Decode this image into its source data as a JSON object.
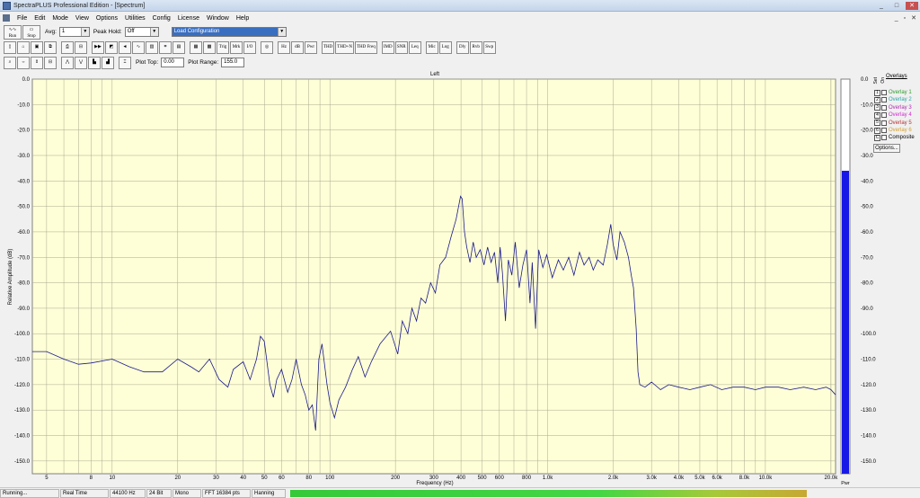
{
  "window": {
    "title": "SpectraPLUS Professional Edition - [Spectrum]",
    "controls": [
      "_",
      "□",
      "✕"
    ],
    "mdi_controls": [
      "_",
      "▫",
      "✕"
    ]
  },
  "menu": [
    "File",
    "Edit",
    "Mode",
    "View",
    "Options",
    "Utilities",
    "Config",
    "License",
    "Window",
    "Help"
  ],
  "toolbar1": {
    "run": "Run",
    "stop": "Stop",
    "avg_label": "Avg:",
    "avg_value": "1",
    "peak_hold_label": "Peak Hold:",
    "peak_hold_value": "Off",
    "config_value": "Load Configuration"
  },
  "toolbar2": {
    "buttons": [
      "Trig",
      "Mrk",
      "I/O",
      "Hz",
      "dB",
      "Pwr",
      "THD",
      "THD+N",
      "THD Freq",
      "IMD",
      "SNR",
      "Leq",
      "Mic",
      "Log",
      "Dly",
      "Rvb",
      "Swp"
    ]
  },
  "toolbar3": {
    "plot_top_label": "Plot Top:",
    "plot_top_value": "0.00",
    "plot_range_label": "Plot Range:",
    "plot_range_value": "155.0"
  },
  "overlays": {
    "title": "Overlays",
    "set_label": "Set",
    "on_label": "On",
    "items": [
      {
        "num": "1",
        "label": "Overlay 1",
        "color": "#2f9a2f"
      },
      {
        "num": "2",
        "label": "Overlay 2",
        "color": "#2aa7a7"
      },
      {
        "num": "3",
        "label": "Overlay 3",
        "color": "#b02ab0"
      },
      {
        "num": "4",
        "label": "Overlay 4",
        "color": "#d02ad0"
      },
      {
        "num": "5",
        "label": "Overlay 5",
        "color": "#b33030"
      },
      {
        "num": "6",
        "label": "Overlay 6",
        "color": "#d4a030"
      },
      {
        "num": "C",
        "label": "Composite",
        "color": "#000000"
      }
    ],
    "options": "Options..."
  },
  "status": {
    "state": "Running...",
    "mode": "Real Time",
    "rate": "44100 Hz",
    "bits": "24 Bit",
    "channels": "Mono",
    "fft": "FFT 16384 pts",
    "window": "Hanning"
  },
  "chart_data": {
    "type": "line",
    "title": "Left",
    "xlabel": "Frequency (Hz)",
    "ylabel": "Relative Amplitude (dB)",
    "x_scale": "log",
    "xlim": [
      4.3,
      21000
    ],
    "ylim": [
      -155,
      0
    ],
    "grid": true,
    "background": "#ffffd7",
    "line_color": "#1a1a8c",
    "x_ticks": [
      {
        "v": 5,
        "l": "5"
      },
      {
        "v": 8,
        "l": "8"
      },
      {
        "v": 10,
        "l": "10"
      },
      {
        "v": 20,
        "l": "20"
      },
      {
        "v": 30,
        "l": "30"
      },
      {
        "v": 40,
        "l": "40"
      },
      {
        "v": 50,
        "l": "50"
      },
      {
        "v": 60,
        "l": "60"
      },
      {
        "v": 80,
        "l": "80"
      },
      {
        "v": 100,
        "l": "100"
      },
      {
        "v": 200,
        "l": "200"
      },
      {
        "v": 300,
        "l": "300"
      },
      {
        "v": 400,
        "l": "400"
      },
      {
        "v": 500,
        "l": "500"
      },
      {
        "v": 600,
        "l": "600"
      },
      {
        "v": 800,
        "l": "800"
      },
      {
        "v": 1000,
        "l": "1.0k"
      },
      {
        "v": 2000,
        "l": "2.0k"
      },
      {
        "v": 3000,
        "l": "3.0k"
      },
      {
        "v": 4000,
        "l": "4.0k"
      },
      {
        "v": 5000,
        "l": "5.0k"
      },
      {
        "v": 6000,
        "l": "6.0k"
      },
      {
        "v": 8000,
        "l": "8.0k"
      },
      {
        "v": 10000,
        "l": "10.0k"
      },
      {
        "v": 20000,
        "l": "20.0k"
      }
    ],
    "y_ticks": [
      0,
      -10,
      -20,
      -30,
      -40,
      -50,
      -60,
      -70,
      -80,
      -90,
      -100,
      -110,
      -120,
      -130,
      -140,
      -150
    ],
    "y_tick_labels": [
      "0.0",
      "-10.0",
      "-20.0",
      "-30.0",
      "-40.0",
      "-50.0",
      "-60.0",
      "-70.0",
      "-80.0",
      "-90.0",
      "-100.0",
      "-110.0",
      "-120.0",
      "-130.0",
      "-140.0",
      "-150.0"
    ],
    "series": [
      {
        "points": [
          [
            4.3,
            -107
          ],
          [
            5,
            -107
          ],
          [
            6,
            -110
          ],
          [
            7,
            -112
          ],
          [
            8,
            -111.5
          ],
          [
            10,
            -110
          ],
          [
            12,
            -113
          ],
          [
            14,
            -115
          ],
          [
            17,
            -115
          ],
          [
            20,
            -110
          ],
          [
            23,
            -113
          ],
          [
            25,
            -115
          ],
          [
            28,
            -110
          ],
          [
            31,
            -118
          ],
          [
            34,
            -121
          ],
          [
            36,
            -114
          ],
          [
            40,
            -111
          ],
          [
            43,
            -118
          ],
          [
            46,
            -110
          ],
          [
            48,
            -101
          ],
          [
            50,
            -103
          ],
          [
            53,
            -120
          ],
          [
            55,
            -125
          ],
          [
            57,
            -118
          ],
          [
            60,
            -114
          ],
          [
            64,
            -123
          ],
          [
            67,
            -118
          ],
          [
            70,
            -110
          ],
          [
            74,
            -120
          ],
          [
            77,
            -124
          ],
          [
            80,
            -130
          ],
          [
            83,
            -128
          ],
          [
            86,
            -138
          ],
          [
            89,
            -110
          ],
          [
            92,
            -104
          ],
          [
            97,
            -120
          ],
          [
            100,
            -127
          ],
          [
            105,
            -133
          ],
          [
            110,
            -126
          ],
          [
            118,
            -121
          ],
          [
            127,
            -114
          ],
          [
            135,
            -109
          ],
          [
            145,
            -117
          ],
          [
            155,
            -111
          ],
          [
            170,
            -104
          ],
          [
            190,
            -99
          ],
          [
            205,
            -108
          ],
          [
            215,
            -95
          ],
          [
            228,
            -100
          ],
          [
            238,
            -90
          ],
          [
            250,
            -95
          ],
          [
            262,
            -86
          ],
          [
            275,
            -88
          ],
          [
            290,
            -80
          ],
          [
            305,
            -84
          ],
          [
            320,
            -73
          ],
          [
            340,
            -70
          ],
          [
            360,
            -62
          ],
          [
            380,
            -55
          ],
          [
            398,
            -46
          ],
          [
            405,
            -47
          ],
          [
            415,
            -60
          ],
          [
            425,
            -66
          ],
          [
            440,
            -72
          ],
          [
            455,
            -64
          ],
          [
            470,
            -70
          ],
          [
            490,
            -67
          ],
          [
            510,
            -73
          ],
          [
            530,
            -66
          ],
          [
            550,
            -72
          ],
          [
            570,
            -68
          ],
          [
            590,
            -80
          ],
          [
            605,
            -66
          ],
          [
            620,
            -76
          ],
          [
            640,
            -95
          ],
          [
            660,
            -71
          ],
          [
            685,
            -77
          ],
          [
            710,
            -64
          ],
          [
            740,
            -82
          ],
          [
            770,
            -73
          ],
          [
            800,
            -67
          ],
          [
            830,
            -88
          ],
          [
            850,
            -72
          ],
          [
            880,
            -98
          ],
          [
            910,
            -67
          ],
          [
            950,
            -74
          ],
          [
            990,
            -69
          ],
          [
            1050,
            -78
          ],
          [
            1120,
            -71
          ],
          [
            1180,
            -75
          ],
          [
            1250,
            -70
          ],
          [
            1320,
            -77
          ],
          [
            1400,
            -68
          ],
          [
            1470,
            -73
          ],
          [
            1550,
            -70
          ],
          [
            1620,
            -75
          ],
          [
            1700,
            -71
          ],
          [
            1800,
            -73
          ],
          [
            1880,
            -65
          ],
          [
            1950,
            -57
          ],
          [
            2000,
            -65
          ],
          [
            2080,
            -71
          ],
          [
            2150,
            -60
          ],
          [
            2250,
            -64
          ],
          [
            2350,
            -70
          ],
          [
            2420,
            -77
          ],
          [
            2480,
            -82
          ],
          [
            2550,
            -98
          ],
          [
            2600,
            -115
          ],
          [
            2650,
            -120
          ],
          [
            2800,
            -121
          ],
          [
            3000,
            -119
          ],
          [
            3300,
            -122
          ],
          [
            3600,
            -120
          ],
          [
            4000,
            -121
          ],
          [
            4500,
            -122
          ],
          [
            5000,
            -121
          ],
          [
            5600,
            -120
          ],
          [
            6300,
            -122
          ],
          [
            7100,
            -121
          ],
          [
            8000,
            -121
          ],
          [
            9000,
            -122
          ],
          [
            10000,
            -121
          ],
          [
            11500,
            -121
          ],
          [
            13000,
            -122
          ],
          [
            15000,
            -121
          ],
          [
            17000,
            -122
          ],
          [
            19000,
            -121
          ],
          [
            20000,
            -122
          ],
          [
            21000,
            -124
          ]
        ]
      }
    ]
  },
  "meter": {
    "label": "Pwr",
    "value_db": -36,
    "range": [
      -155,
      0
    ],
    "ticks": [
      0,
      -10,
      -20,
      -30,
      -40,
      -50,
      -60,
      -70,
      -80,
      -90,
      -100,
      -110,
      -120,
      -130,
      -140,
      -150
    ],
    "tick_labels": [
      "0.0",
      "-10.0",
      "-20.0",
      "-30.0",
      "-40.0",
      "-50.0",
      "-60.0",
      "-70.0",
      "-80.0",
      "-90.0",
      "-100.0",
      "-110.0",
      "-120.0",
      "-130.0",
      "-140.0",
      "-150.0"
    ],
    "color": "#1818e6"
  }
}
